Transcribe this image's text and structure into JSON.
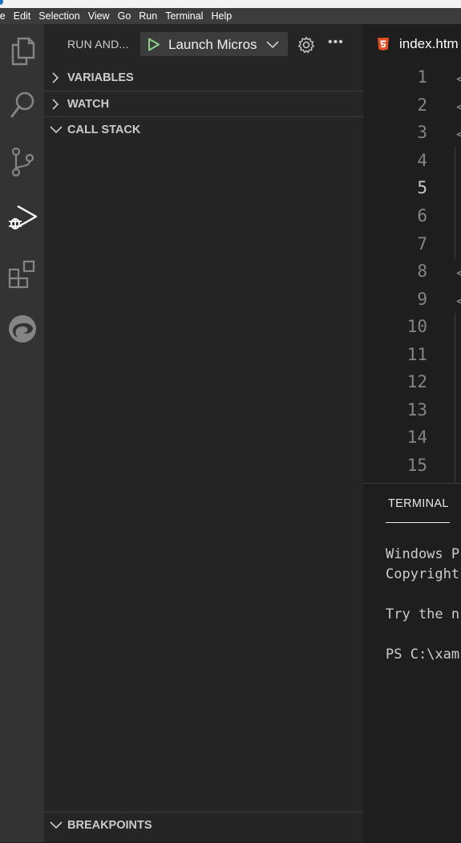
{
  "menubar": {
    "items": [
      "le",
      "Edit",
      "Selection",
      "View",
      "Go",
      "Run",
      "Terminal",
      "Help"
    ]
  },
  "activity_bar": {
    "icons": [
      "explorer-icon",
      "search-icon",
      "source-control-icon",
      "run-debug-icon",
      "extensions-icon",
      "edge-icon"
    ],
    "active": "run-debug-icon"
  },
  "sidebar": {
    "title": "RUN AND...",
    "launch_config": "Launch Micros",
    "sections": {
      "variables": "VARIABLES",
      "watch": "WATCH",
      "call_stack": "CALL STACK",
      "breakpoints": "BREAKPOINTS"
    }
  },
  "editor": {
    "tab_name": "index.htm",
    "line_numbers": [
      "1",
      "2",
      "3",
      "4",
      "5",
      "6",
      "7",
      "8",
      "9",
      "10",
      "11",
      "12",
      "13",
      "14",
      "15"
    ],
    "active_line": "5"
  },
  "panel": {
    "tab": "TERMINAL",
    "lines": [
      "Windows P",
      "Copyright",
      "",
      "Try the n",
      "",
      "PS C:\\xam"
    ]
  },
  "colors": {
    "activity_bg": "#333333",
    "sidebar_bg": "#252526",
    "editor_bg": "#1e1e1e",
    "menubar_bg": "#3c3c3c",
    "play_green": "#89d185",
    "html_orange": "#e44d26"
  }
}
